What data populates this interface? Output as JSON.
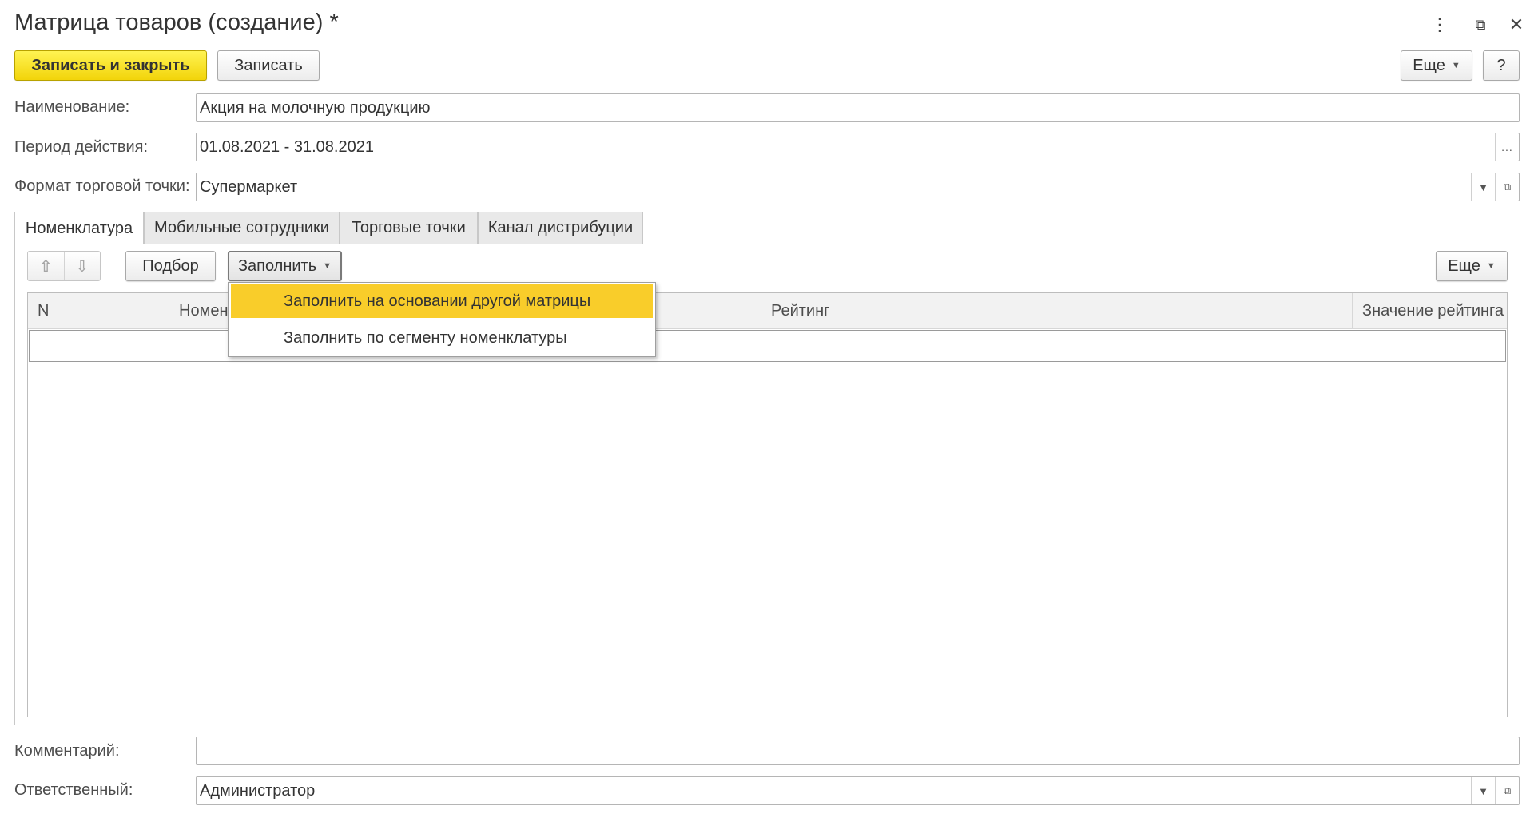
{
  "window": {
    "title": "Матрица товаров (создание) *",
    "more_icon": "⋮",
    "restore_icon": "⧉",
    "close_icon": "✕"
  },
  "toolbar": {
    "save_close_label": "Записать и закрыть",
    "save_label": "Записать",
    "more_label": "Еще",
    "help_label": "?"
  },
  "form": {
    "name_label": "Наименование:",
    "name_value": "Акция на молочную продукцию",
    "period_label": "Период действия:",
    "period_value": "01.08.2021 - 31.08.2021",
    "period_button": "...",
    "format_label": "Формат торговой точки:",
    "format_value": "Супермаркет",
    "comment_label": "Комментарий:",
    "comment_value": "",
    "responsible_label": "Ответственный:",
    "responsible_value": "Администратор"
  },
  "tabs": [
    {
      "label": "Номенклатура",
      "active": true
    },
    {
      "label": "Мобильные сотрудники",
      "active": false
    },
    {
      "label": "Торговые точки",
      "active": false
    },
    {
      "label": "Канал дистрибуции",
      "active": false
    }
  ],
  "tab_toolbar": {
    "pick_label": "Подбор",
    "fill_label": "Заполнить",
    "more_label": "Еще"
  },
  "table": {
    "columns": [
      "N",
      "Номен",
      "Рейтинг",
      "Значение рейтинга"
    ]
  },
  "fill_menu": {
    "items": [
      {
        "label": "Заполнить на основании другой матрицы",
        "highlighted": true
      },
      {
        "label": "Заполнить по сегменту номенклатуры",
        "highlighted": false
      }
    ]
  },
  "colors": {
    "primary_button": "#f2d40a",
    "menu_highlight": "#f9cd2a"
  }
}
